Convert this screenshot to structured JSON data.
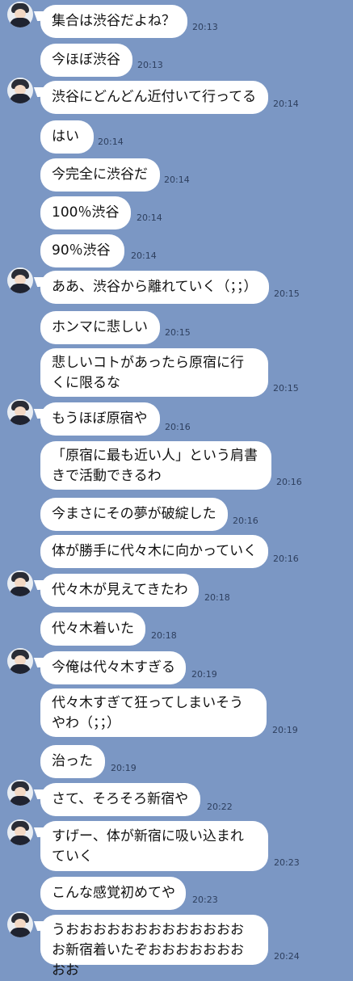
{
  "messages": [
    {
      "text": "集合は渋谷だよね？",
      "time": "20:13",
      "avatar": true
    },
    {
      "text": "今ほぼ渋谷",
      "time": "20:13",
      "avatar": false
    },
    {
      "text": "渋谷にどんどん近付いて行ってる",
      "time": "20:14",
      "avatar": true
    },
    {
      "text": "はい",
      "time": "20:14",
      "avatar": false
    },
    {
      "text": "今完全に渋谷だ",
      "time": "20:14",
      "avatar": false
    },
    {
      "text": "100％渋谷",
      "time": "20:14",
      "avatar": false
    },
    {
      "text": "90％渋谷",
      "time": "20:14",
      "avatar": false
    },
    {
      "text": "ああ、渋谷から離れていく（；；）",
      "time": "20:15",
      "avatar": true
    },
    {
      "text": "ホンマに悲しい",
      "time": "20:15",
      "avatar": false
    },
    {
      "text": "悲しいコトがあったら原宿に行くに限るな",
      "time": "20:15",
      "avatar": false
    },
    {
      "text": "もうほぼ原宿や",
      "time": "20:16",
      "avatar": true
    },
    {
      "text": "「原宿に最も近い人」という肩書きで活動できるわ",
      "time": "20:16",
      "avatar": false
    },
    {
      "text": "今まさにその夢が破綻した",
      "time": "20:16",
      "avatar": false
    },
    {
      "text": "体が勝手に代々木に向かっていく",
      "time": "20:16",
      "avatar": false
    },
    {
      "text": "代々木が見えてきたわ",
      "time": "20:18",
      "avatar": true
    },
    {
      "text": "代々木着いた",
      "time": "20:18",
      "avatar": false
    },
    {
      "text": "今俺は代々木すぎる",
      "time": "20:19",
      "avatar": true
    },
    {
      "text": "代々木すぎて狂ってしまいそうやわ（；；）",
      "time": "20:19",
      "avatar": false
    },
    {
      "text": "治った",
      "time": "20:19",
      "avatar": false
    },
    {
      "text": "さて、そろそろ新宿や",
      "time": "20:22",
      "avatar": true
    },
    {
      "text": "すげー、体が新宿に吸い込まれていく",
      "time": "20:23",
      "avatar": true
    },
    {
      "text": "こんな感覚初めてや",
      "time": "20:23",
      "avatar": false
    },
    {
      "text": "うおおおおおおおおおおおおおお新宿着いたぞおおおおおおおおお",
      "time": "20:24",
      "avatar": true
    }
  ]
}
